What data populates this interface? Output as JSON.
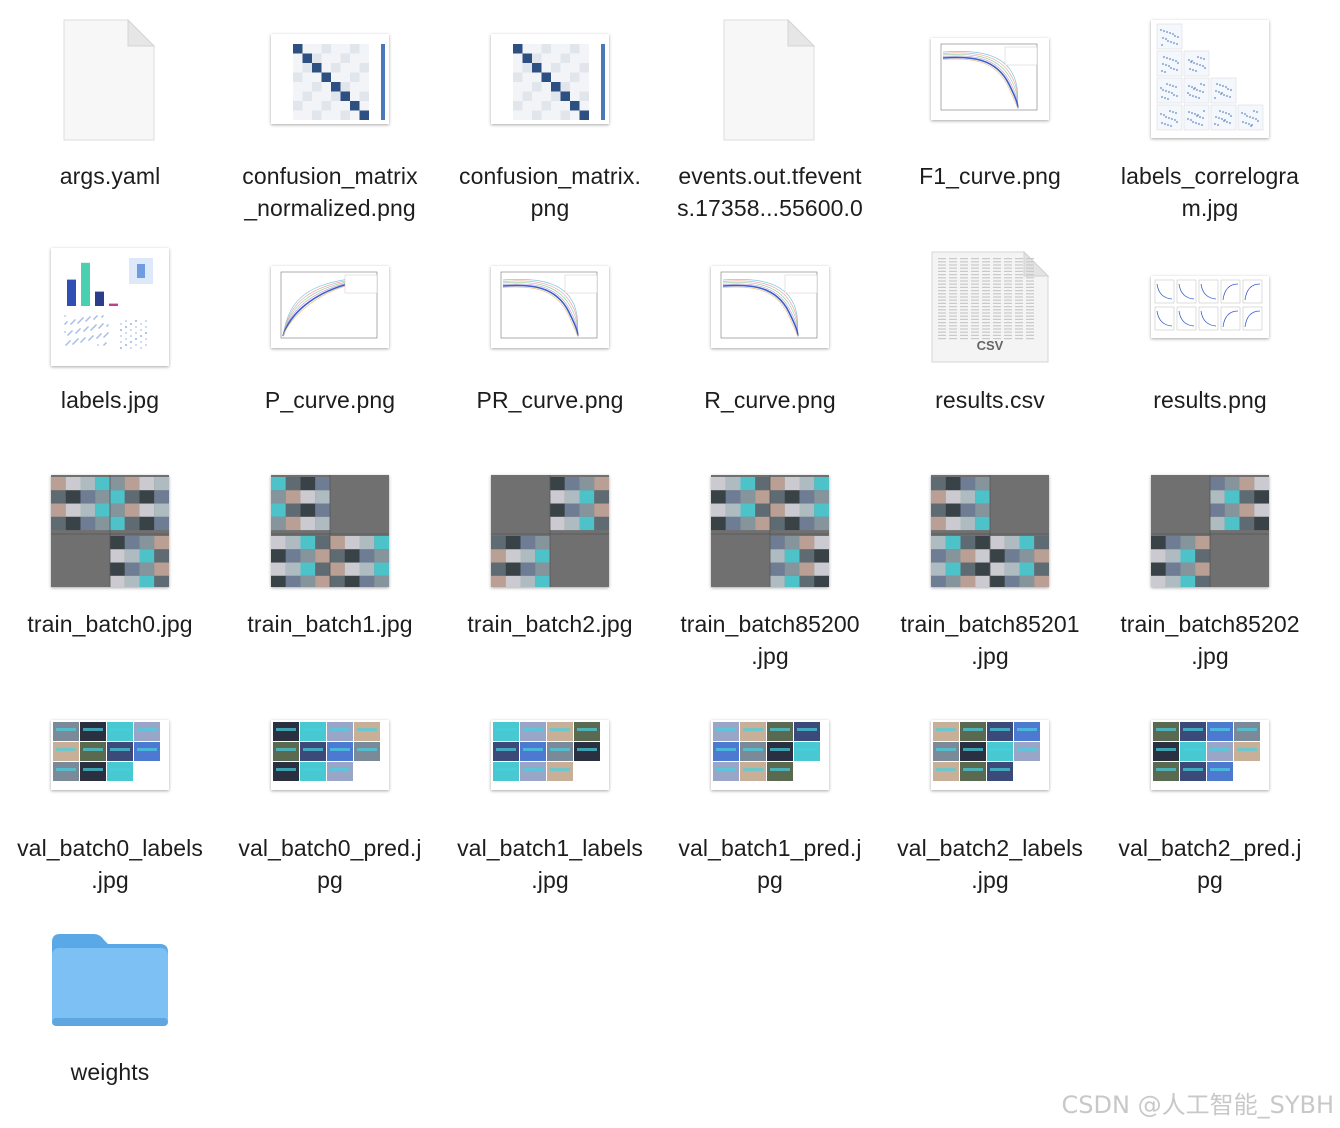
{
  "files": [
    {
      "name": "args.yaml",
      "kind": "document",
      "icon": "yaml-file-icon"
    },
    {
      "name": "confusion_matrix\n_normalized.png",
      "kind": "matrix",
      "icon": "confusion-matrix-thumbnail"
    },
    {
      "name": "confusion_matrix.\npng",
      "kind": "matrix",
      "icon": "confusion-matrix-thumbnail"
    },
    {
      "name": "events.out.tfevent\ns.17358...55600.0",
      "kind": "document",
      "icon": "generic-file-icon"
    },
    {
      "name": "F1_curve.png",
      "kind": "curve-down",
      "icon": "curve-plot-thumbnail"
    },
    {
      "name": "labels_correlogra\nm.jpg",
      "kind": "correlogram",
      "icon": "correlogram-thumbnail"
    },
    {
      "name": "labels.jpg",
      "kind": "labels",
      "icon": "labels-thumbnail"
    },
    {
      "name": "P_curve.png",
      "kind": "curve-up",
      "icon": "curve-plot-thumbnail"
    },
    {
      "name": "PR_curve.png",
      "kind": "curve-down",
      "icon": "curve-plot-thumbnail"
    },
    {
      "name": "R_curve.png",
      "kind": "curve-down",
      "icon": "curve-plot-thumbnail"
    },
    {
      "name": "results.csv",
      "kind": "csv",
      "icon": "csv-file-icon",
      "badge": "CSV"
    },
    {
      "name": "results.png",
      "kind": "results",
      "icon": "results-plot-thumbnail"
    },
    {
      "name": "train_batch0.jpg",
      "kind": "photo",
      "icon": "photo-grid-thumbnail"
    },
    {
      "name": "train_batch1.jpg",
      "kind": "photo",
      "icon": "photo-grid-thumbnail"
    },
    {
      "name": "train_batch2.jpg",
      "kind": "photo",
      "icon": "photo-grid-thumbnail"
    },
    {
      "name": "train_batch85200\n.jpg",
      "kind": "photo",
      "icon": "photo-grid-thumbnail"
    },
    {
      "name": "train_batch85201\n.jpg",
      "kind": "photo",
      "icon": "photo-grid-thumbnail"
    },
    {
      "name": "train_batch85202\n.jpg",
      "kind": "photo",
      "icon": "photo-grid-thumbnail"
    },
    {
      "name": "val_batch0_labels\n.jpg",
      "kind": "val",
      "icon": "photo-mosaic-thumbnail"
    },
    {
      "name": "val_batch0_pred.j\npg",
      "kind": "val",
      "icon": "photo-mosaic-thumbnail"
    },
    {
      "name": "val_batch1_labels\n.jpg",
      "kind": "val",
      "icon": "photo-mosaic-thumbnail"
    },
    {
      "name": "val_batch1_pred.j\npg",
      "kind": "val",
      "icon": "photo-mosaic-thumbnail"
    },
    {
      "name": "val_batch2_labels\n.jpg",
      "kind": "val",
      "icon": "photo-mosaic-thumbnail"
    },
    {
      "name": "val_batch2_pred.j\npg",
      "kind": "val",
      "icon": "photo-mosaic-thumbnail"
    },
    {
      "name": "weights",
      "kind": "folder",
      "icon": "folder-icon"
    }
  ],
  "watermark": "CSDN @人工智能_SYBH",
  "colors": {
    "folder": "#6fb9f0",
    "folder_tab": "#5aa8e6",
    "plot_blue": "#3a5fcd",
    "matrix_dark": "#08306b"
  }
}
